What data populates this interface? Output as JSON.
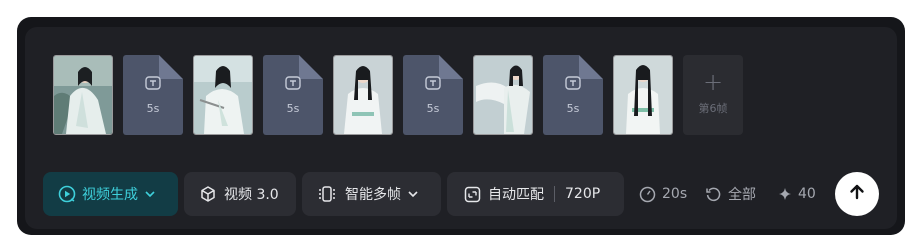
{
  "frames": {
    "segments": [
      {
        "duration": "5s",
        "icon": "text-frame-icon"
      },
      {
        "duration": "5s",
        "icon": "text-frame-icon"
      },
      {
        "duration": "5s",
        "icon": "text-frame-icon"
      },
      {
        "duration": "5s",
        "icon": "text-frame-icon"
      }
    ],
    "add_label": "第6帧",
    "add_symbol": "+"
  },
  "toolbar": {
    "mode": {
      "label": "视频生成",
      "icon": "video-play-icon",
      "color": "#3ed0db"
    },
    "model": {
      "label": "视频 3.0",
      "icon": "cube-icon"
    },
    "frame_mode": {
      "label": "智能多帧",
      "icon": "multi-frame-icon"
    },
    "ratio": {
      "label": "自动匹配",
      "resolution": "720P",
      "icon": "aspect-ratio-icon"
    },
    "duration": {
      "label": "20s",
      "icon": "timer-icon"
    },
    "scope": {
      "label": "全部",
      "icon": "refresh-icon"
    },
    "credits": {
      "label": "40",
      "icon": "sparkle-icon"
    },
    "submit_icon": "arrow-up-icon"
  },
  "colors": {
    "panel": "#1f2025",
    "segment": "#4d556a",
    "accent": "#3ed0db"
  }
}
